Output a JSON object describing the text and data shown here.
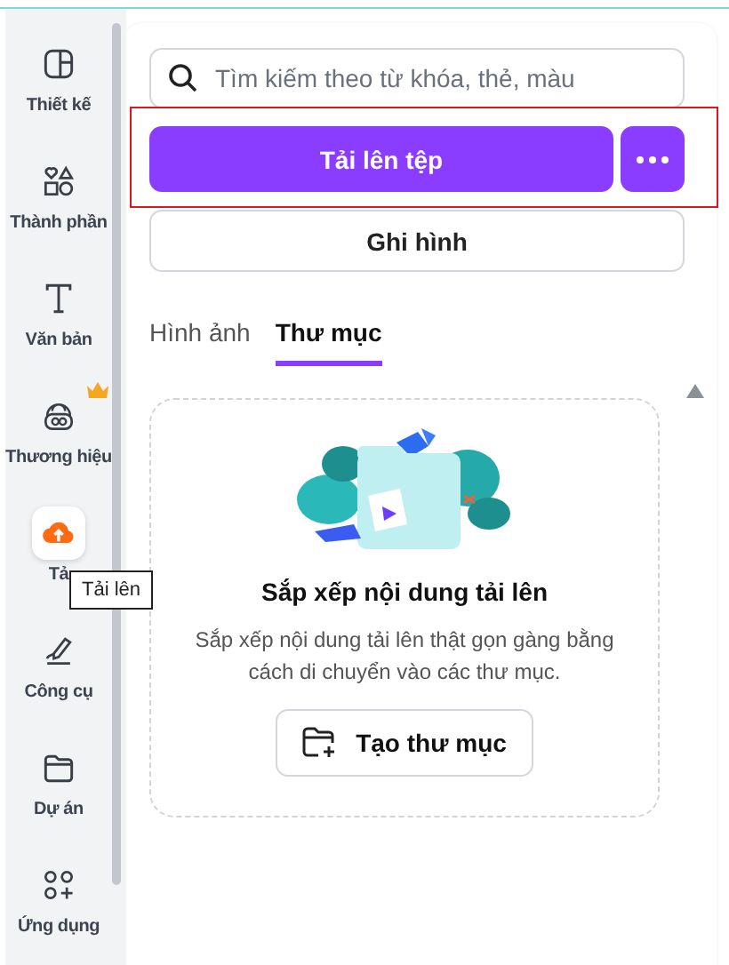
{
  "sidebar": {
    "items": [
      {
        "label": "Thiết kế",
        "selected": false,
        "premium": false
      },
      {
        "label": "Thành phần",
        "selected": false,
        "premium": false
      },
      {
        "label": "Văn bản",
        "selected": false,
        "premium": false
      },
      {
        "label": "Thương hiệu",
        "selected": false,
        "premium": true
      },
      {
        "label": "Tả",
        "selected": true,
        "premium": false
      },
      {
        "label": "Công cụ",
        "selected": false,
        "premium": false
      },
      {
        "label": "Dự án",
        "selected": false,
        "premium": false
      },
      {
        "label": "Ứng dụng",
        "selected": false,
        "premium": false
      }
    ]
  },
  "tooltip": "Tải lên",
  "search": {
    "placeholder": "Tìm kiếm theo từ khóa, thẻ, màu"
  },
  "upload_button": "Tải lên tệp",
  "record_button": "Ghi hình",
  "tabs": [
    {
      "label": "Hình ảnh",
      "selected": false
    },
    {
      "label": "Thư mục",
      "selected": true
    }
  ],
  "empty_state": {
    "title": "Sắp xếp nội dung tải lên",
    "description": "Sắp xếp nội dung tải lên thật gọn gàng bằng cách di chuyển vào các thư mục.",
    "button": "Tạo thư mục"
  }
}
